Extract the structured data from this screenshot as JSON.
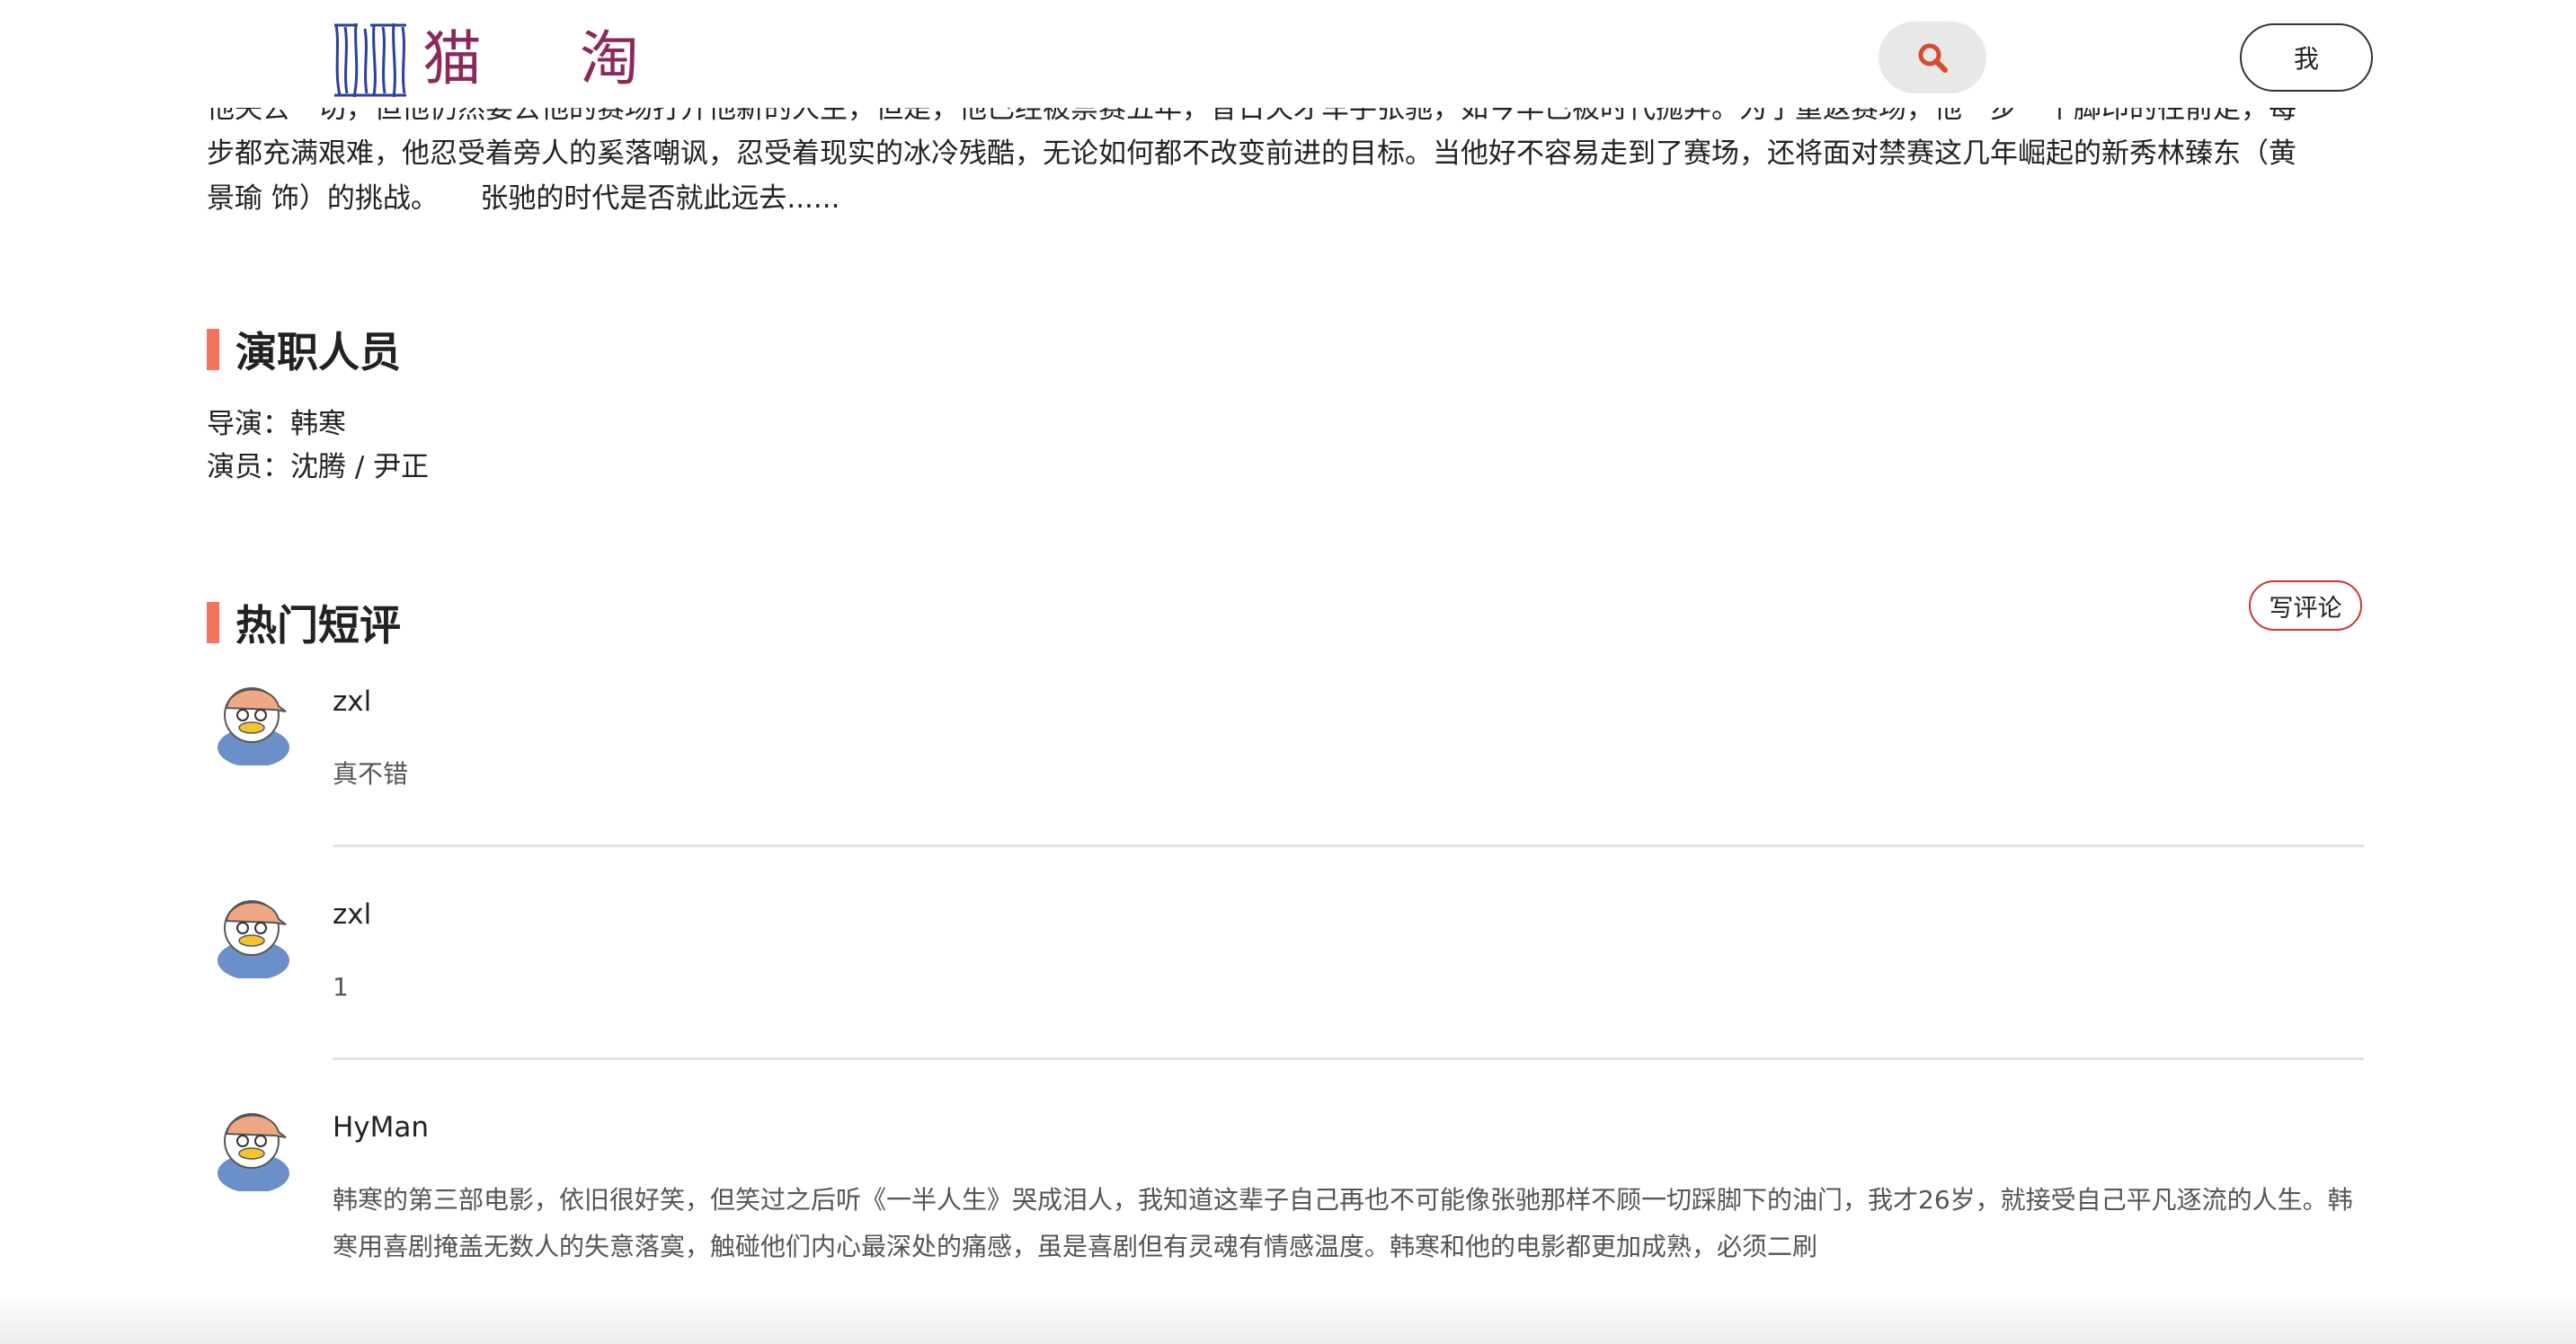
{
  "header": {
    "logo_text": "猫 淘",
    "me_label": "我"
  },
  "synopsis": {
    "line0": "他失去一切，但他仍然要去他的赛场打开他新的人生，但是，他已经被禁赛五年，昔日天才车手张驰，如今早已被时代抛弃。为了重返赛场，他一步一个脚印的往前走，每一",
    "line1": "步都充满艰难，他忍受着旁人的奚落嘲讽，忍受着现实的冰冷残酷，无论如何都不改变前进的目标。当他好不容易走到了赛场，还将面对禁赛这几年崛起的新秀林臻东（黄",
    "line2": "景瑜 饰）的挑战。　　张驰的时代是否就此远去......"
  },
  "cast_section": {
    "title": "演职人员",
    "director": "导演：韩寒",
    "actors": "演员：沈腾 / 尹正"
  },
  "reviews_section": {
    "title": "热门短评",
    "write_label": "写评论",
    "comments": [
      {
        "user": "zxl",
        "text": "真不错"
      },
      {
        "user": "zxl",
        "text": "1"
      },
      {
        "user": "HyMan",
        "text": "韩寒的第三部电影，依旧很好笑，但笑过之后听《一半人生》哭成泪人，我知道这辈子自己再也不可能像张驰那样不顾一切踩脚下的油门，我才26岁，就接受自己平凡逐流的人生。韩寒用喜剧掩盖无数人的失意落寞，触碰他们内心最深处的痛感，虽是喜剧但有灵魂有情感温度。韩寒和他的电影都更加成熟，必须二刷"
      }
    ]
  },
  "icons": {
    "search": "search-icon",
    "avatar": "avatar-duck-icon",
    "logo": "logo-mark-icon"
  },
  "colors": {
    "accent_bar": "#f4735c",
    "write_border": "#c8362e",
    "search_icon": "#d84a2c",
    "logo": "#8a2a5c"
  }
}
